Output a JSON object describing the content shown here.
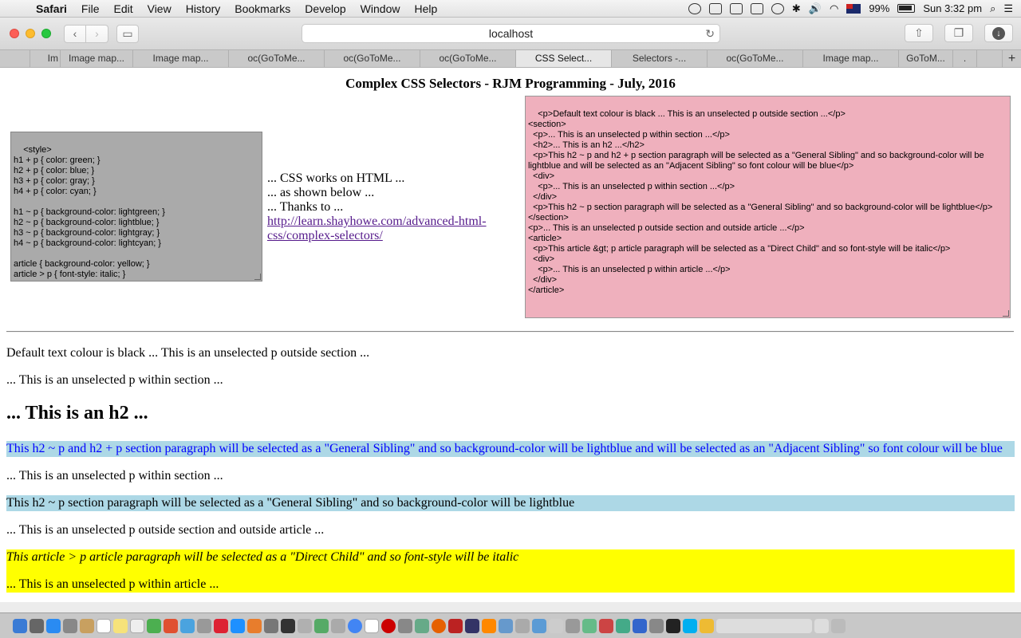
{
  "menubar": {
    "app": "Safari",
    "items": [
      "File",
      "Edit",
      "View",
      "History",
      "Bookmarks",
      "Develop",
      "Window",
      "Help"
    ],
    "battery": "99%",
    "clock": "Sun 3:32 pm"
  },
  "toolbar": {
    "address": "localhost"
  },
  "tabs": [
    {
      "label": "Im"
    },
    {
      "label": "Image map..."
    },
    {
      "label": "Image map..."
    },
    {
      "label": "oc(GoToMe..."
    },
    {
      "label": "oc(GoToMe..."
    },
    {
      "label": "oc(GoToMe..."
    },
    {
      "label": "CSS Select..."
    },
    {
      "label": "Selectors -..."
    },
    {
      "label": "oc(GoToMe..."
    },
    {
      "label": "Image map..."
    },
    {
      "label": "GoToM..."
    },
    {
      "label": "."
    }
  ],
  "page": {
    "title": "Complex CSS Selectors - RJM Programming - July, 2016",
    "style_textarea": "<style>\nh1 + p { color: green; }\nh2 + p { color: blue; }\nh3 + p { color: gray; }\nh4 + p { color: cyan; }\n\nh1 ~ p { background-color: lightgreen; }\nh2 ~ p { background-color: lightblue; }\nh3 ~ p { background-color: lightgray; }\nh4 ~ p { background-color: lightcyan; }\n\narticle { background-color: yellow; }\narticle > p { font-style: italic; }\n</style>",
    "mid_line1": "... CSS works on HTML ...",
    "mid_line2": "... as shown below ...",
    "mid_line3": "... Thanks to ...",
    "link": "http://learn.shayhowe.com/advanced-html-css/complex-selectors/",
    "html_textarea": "<p>Default text colour is black ... This is an unselected p outside section ...</p>\n<section>\n  <p>... This is an unselected p within section ...</p>\n  <h2>... This is an h2 ...</h2>\n  <p>This h2 ~ p and h2 + p section paragraph will be selected as a \"General Sibling\" and so background-color will be lightblue and will be selected as an \"Adjacent Sibling\" so font colour will be blue</p>\n  <div>\n    <p>... This is an unselected p within section ...</p>\n  </div>\n  <p>This h2 ~ p section paragraph will be selected as a \"General Sibling\" and so background-color will be lightblue</p>\n</section>\n<p>... This is an unselected p outside section and outside article ...</p>\n<article>\n  <p>This article &gt; p article paragraph will be selected as a \"Direct Child\" and so font-style will be italic</p>\n  <div>\n    <p>... This is an unselected p within article ...</p>\n  </div>\n</article>",
    "out1": "Default text colour is black ... This is an unselected p outside section ...",
    "out2": "... This is an unselected p within section ...",
    "out_h2": "... This is an h2 ...",
    "out3": "This h2 ~ p and h2 + p section paragraph will be selected as a \"General Sibling\" and so background-color will be lightblue and will be selected as an \"Adjacent Sibling\" so font colour will be blue",
    "out4": "... This is an unselected p within section ...",
    "out5": "This h2 ~ p section paragraph will be selected as a \"General Sibling\" and so background-color will be lightblue",
    "out6": "... This is an unselected p outside section and outside article ...",
    "out7": "This article > p article paragraph will be selected as a \"Direct Child\" and so font-style will be italic",
    "out8": "... This is an unselected p within article ..."
  },
  "colors": {
    "style_textarea_bg": "#aaaaaa",
    "html_textarea_bg": "#efb0bd",
    "lightblue": "#add8e6",
    "yellow": "#ffff00",
    "blue": "#0000ff"
  }
}
